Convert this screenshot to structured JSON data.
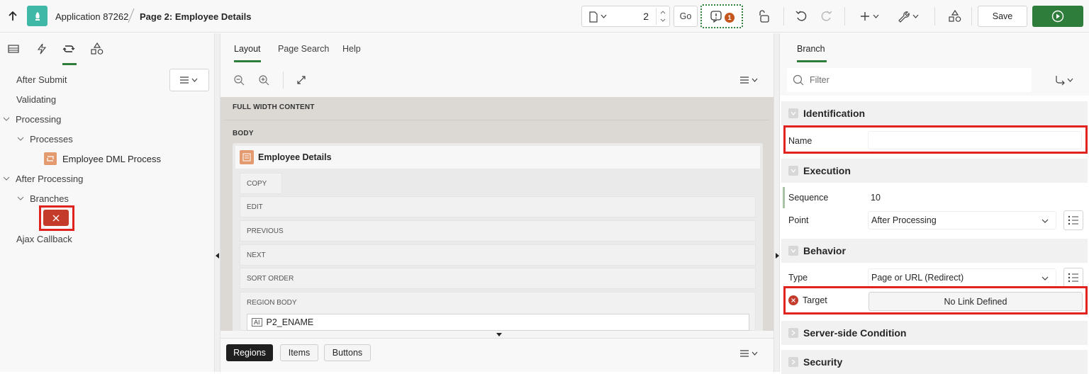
{
  "toolbar": {
    "app_name": "Application 87262",
    "page_title": "Page 2: Employee Details",
    "page_number": "2",
    "go_label": "Go",
    "issues_count": "1",
    "save_label": "Save"
  },
  "left": {
    "tree": [
      {
        "label": "After Submit"
      },
      {
        "label": "Validating"
      },
      {
        "label": "Processing"
      },
      {
        "label": "Processes"
      },
      {
        "label": "Employee DML Process"
      },
      {
        "label": "After Processing"
      },
      {
        "label": "Branches"
      },
      {
        "label": "Ajax Callback"
      }
    ]
  },
  "center": {
    "tabs": [
      "Layout",
      "Page Search",
      "Help"
    ],
    "full_width_label": "FULL WIDTH CONTENT",
    "body_label": "BODY",
    "region_title": "Employee Details",
    "slots": [
      "COPY",
      "EDIT",
      "PREVIOUS",
      "NEXT",
      "SORT ORDER",
      "REGION BODY"
    ],
    "item_label": "P2_ENAME",
    "item_badge": "AI",
    "bottom_tabs": [
      "Regions",
      "Items",
      "Buttons"
    ]
  },
  "right": {
    "tab": "Branch",
    "filter_placeholder": "Filter",
    "groups": {
      "identification": "Identification",
      "execution": "Execution",
      "behavior": "Behavior",
      "server_side": "Server-side Condition",
      "security": "Security"
    },
    "props": {
      "name_label": "Name",
      "name_value": "",
      "sequence_label": "Sequence",
      "sequence_value": "10",
      "point_label": "Point",
      "point_value": "After Processing",
      "type_label": "Type",
      "type_value": "Page or URL (Redirect)",
      "target_label": "Target",
      "target_value": "No Link Defined"
    }
  },
  "colors": {
    "accent_green": "#2f7d3a",
    "error_red": "#c43b2b",
    "highlight_red": "#e0231f",
    "app_teal": "#3fb8a8",
    "process_orange": "#e39a6e"
  }
}
